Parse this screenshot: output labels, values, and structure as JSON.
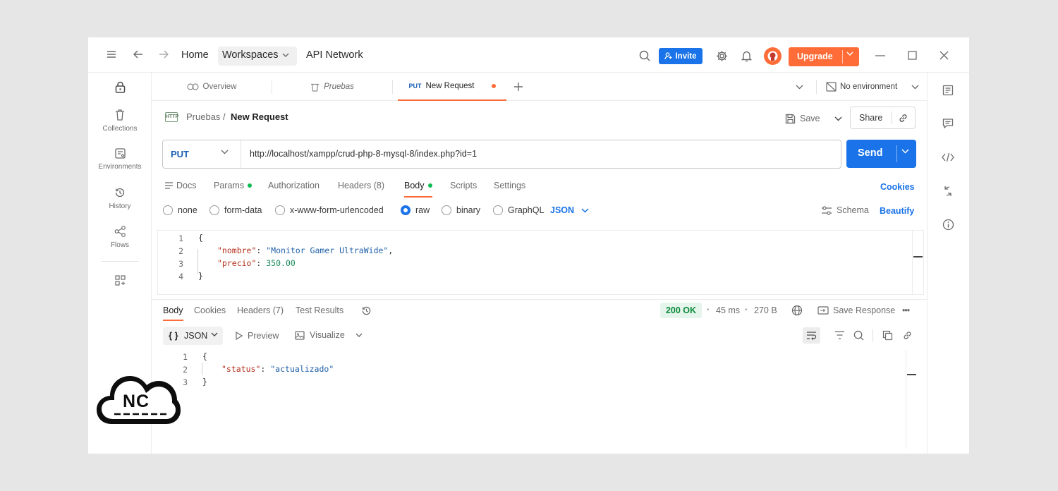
{
  "titlebar": {
    "home": "Home",
    "workspaces": "Workspaces",
    "api_network": "API Network",
    "invite": "Invite",
    "upgrade": "Upgrade"
  },
  "sidebar": {
    "items": [
      {
        "label": "Collections"
      },
      {
        "label": "Environments"
      },
      {
        "label": "History"
      },
      {
        "label": "Flows"
      }
    ]
  },
  "tabs": {
    "overview": "Overview",
    "pruebas": "Pruebas",
    "active_method": "PUT",
    "active_label": "New Request",
    "environment": "No environment"
  },
  "breadcrumb": {
    "badge": "HTTP",
    "parent": "Pruebas",
    "separator": "/",
    "current": "New Request",
    "save": "Save",
    "share": "Share"
  },
  "request": {
    "method": "PUT",
    "url": "http://localhost/xampp/crud-php-8-mysql-8/index.php?id=1",
    "send": "Send"
  },
  "request_tabs": {
    "docs": "Docs",
    "params": "Params",
    "authorization": "Authorization",
    "headers": "Headers (8)",
    "body": "Body",
    "scripts": "Scripts",
    "settings": "Settings",
    "cookies": "Cookies"
  },
  "body_types": {
    "none": "none",
    "form_data": "form-data",
    "urlencoded": "x-www-form-urlencoded",
    "raw": "raw",
    "binary": "binary",
    "graphql": "GraphQL",
    "format": "JSON",
    "schema": "Schema",
    "beautify": "Beautify",
    "selected": "raw"
  },
  "request_body": {
    "lines": [
      {
        "num": "1",
        "open": "{"
      },
      {
        "num": "2",
        "key": "\"nombre\"",
        "colon": ": ",
        "value": "\"Monitor Gamer UltraWide\"",
        "comma": ","
      },
      {
        "num": "3",
        "key": "\"precio\"",
        "colon": ": ",
        "value": "350.00"
      },
      {
        "num": "4",
        "close": "}"
      }
    ]
  },
  "response": {
    "tabs": {
      "body": "Body",
      "cookies": "Cookies",
      "headers": "Headers (7)",
      "test_results": "Test Results"
    },
    "status": "200 OK",
    "time": "45 ms",
    "size": "270 B",
    "save_response": "Save Response",
    "more": "•••",
    "view": {
      "format_brace": "{ }",
      "format": "JSON",
      "preview": "Preview",
      "visualize": "Visualize"
    },
    "lines": [
      {
        "num": "1",
        "open": "{"
      },
      {
        "num": "2",
        "key": "\"status\"",
        "colon": ": ",
        "value": "\"actualizado\""
      },
      {
        "num": "3",
        "close": "}"
      }
    ]
  },
  "logo": {
    "text": "NC"
  },
  "colors": {
    "accent_orange": "#ff6c37",
    "primary_blue": "#1a73e8",
    "success_green": "#0cbb52"
  }
}
